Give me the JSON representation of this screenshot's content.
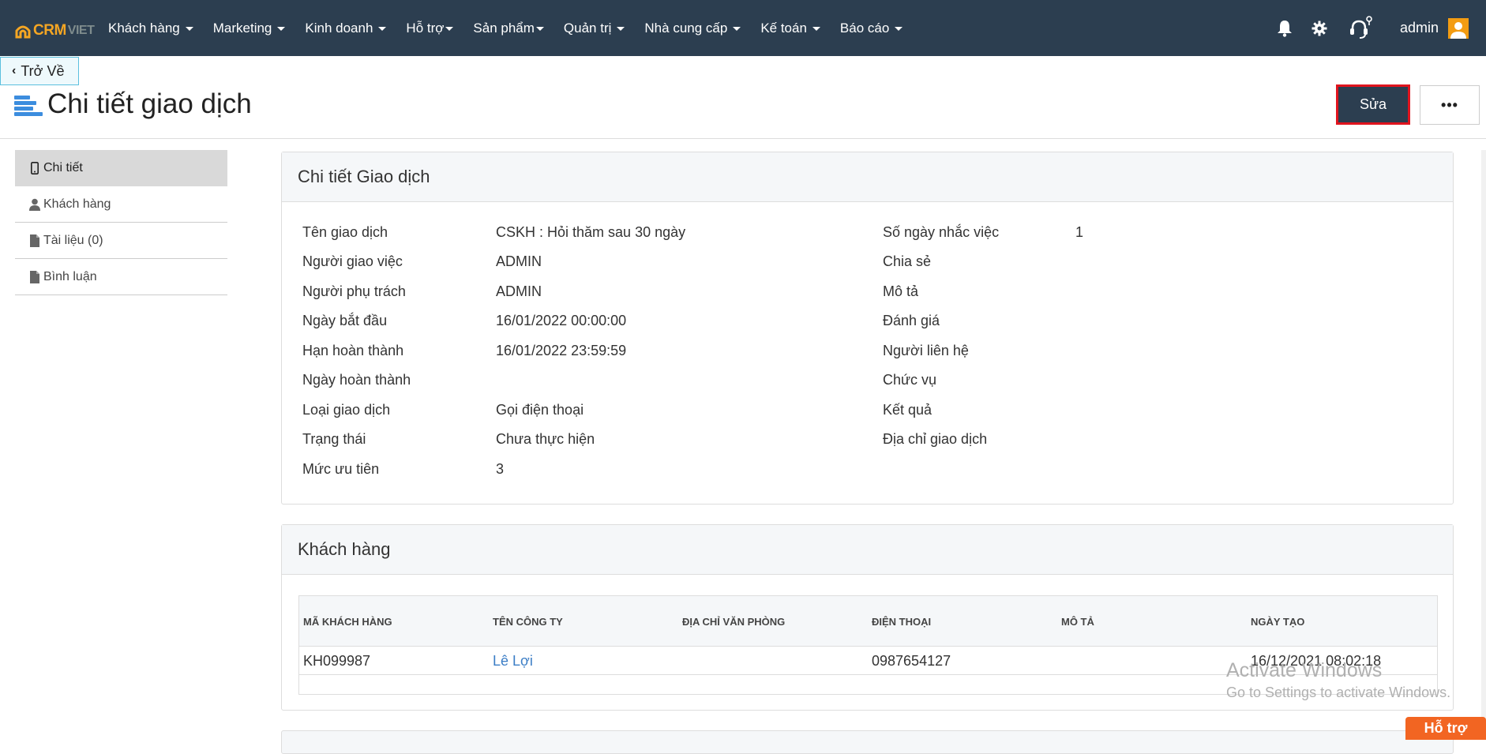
{
  "brand": {
    "logo_text_1": "CRM",
    "logo_text_2": "VIET"
  },
  "nav": {
    "items": [
      "Khách hàng",
      "Marketing",
      "Kinh doanh",
      "Hỗ trợ",
      "Sản phẩm",
      "Quản trị",
      "Nhà cung cấp",
      "Kế toán",
      "Báo cáo"
    ],
    "user": "admin"
  },
  "back_label": "Trở Về",
  "page_title": "Chi tiết giao dịch",
  "actions": {
    "edit_label": "Sửa",
    "more_label": "•••"
  },
  "sidebar": {
    "items": [
      {
        "label": "Chi tiết",
        "icon": "mobile-icon"
      },
      {
        "label": "Khách hàng",
        "icon": "user-icon"
      },
      {
        "label": "Tài liệu (0)",
        "icon": "file-icon"
      },
      {
        "label": "Bình luận",
        "icon": "file-icon"
      }
    ]
  },
  "detail": {
    "title": "Chi tiết Giao dịch",
    "left": [
      {
        "label": "Tên giao dịch",
        "value": "CSKH : Hỏi thăm sau 30 ngày"
      },
      {
        "label": "Người giao việc",
        "value": "ADMIN"
      },
      {
        "label": "Người phụ trách",
        "value": "ADMIN"
      },
      {
        "label": "Ngày bắt đầu",
        "value": "16/01/2022 00:00:00"
      },
      {
        "label": "Hạn hoàn thành",
        "value": "16/01/2022 23:59:59"
      },
      {
        "label": "Ngày hoàn thành",
        "value": ""
      },
      {
        "label": "Loại giao dịch",
        "value": "Gọi điện thoại"
      },
      {
        "label": "Trạng thái",
        "value": "Chưa thực hiện"
      },
      {
        "label": "Mức ưu tiên",
        "value": "3"
      }
    ],
    "right": [
      {
        "label": "Số ngày nhắc việc",
        "value": "1"
      },
      {
        "label": "Chia sẻ",
        "value": ""
      },
      {
        "label": "Mô tả",
        "value": ""
      },
      {
        "label": "Đánh giá",
        "value": ""
      },
      {
        "label": "Người liên hệ",
        "value": ""
      },
      {
        "label": "Chức vụ",
        "value": ""
      },
      {
        "label": "Kết quả",
        "value": ""
      },
      {
        "label": "Địa chỉ giao dịch",
        "value": ""
      }
    ]
  },
  "customers": {
    "title": "Khách hàng",
    "columns": [
      "Mã khách hàng",
      "Tên công ty",
      "Địa chỉ văn phòng",
      "Điện thoại",
      "Mô tả",
      "Ngày tạo"
    ],
    "rows": [
      [
        "KH099987",
        "Lê Lợi",
        "",
        "0987654127",
        "",
        "16/12/2021 08:02:18"
      ]
    ]
  },
  "watermark": {
    "line1": "Activate Windows",
    "line2": "Go to Settings to activate Windows."
  },
  "support_label": "Hỗ trợ",
  "colors": {
    "nav_bg": "#2c3e50",
    "accent": "#3c8dde",
    "support": "#f26522",
    "highlight_border": "#e0141e"
  }
}
